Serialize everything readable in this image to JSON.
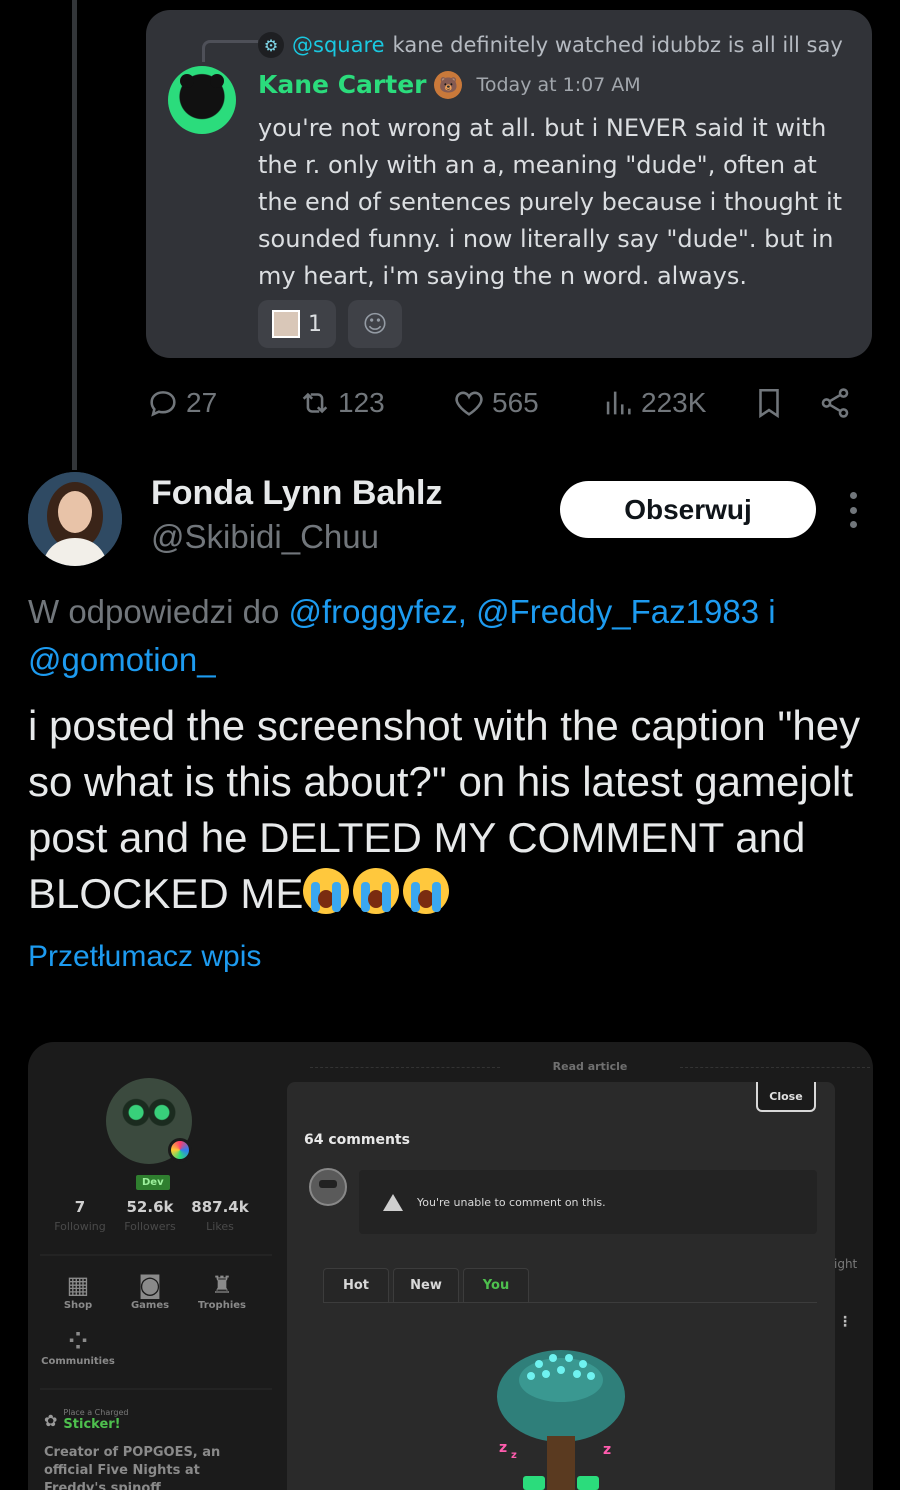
{
  "discord": {
    "reply_name": "@square",
    "reply_text": "kane definitely watched idubbz is all ill say",
    "author": "Kane Carter",
    "timestamp": "Today at 1:07 AM",
    "message": "you're not wrong at all. but i NEVER said it with the r. only with an a, meaning \"dude\", often at the end of sentences purely because i thought it sounded funny. i now literally say \"dude\". but in my heart, i'm saying the n word. always.",
    "reaction_count": "1",
    "icons": {
      "reply_avatar": "robot-avatar-icon",
      "author_badge": "bear-badge-icon",
      "add_reaction": "add-reaction-icon"
    }
  },
  "actions": {
    "replies": "27",
    "reposts": "123",
    "likes": "565",
    "views": "223K",
    "icons": [
      "reply-icon",
      "repost-icon",
      "like-icon",
      "views-icon",
      "bookmark-icon",
      "share-icon"
    ]
  },
  "tweet": {
    "author_name": "Fonda Lynn Bahlz",
    "handle": "@Skibidi_Chuu",
    "follow_label": "Obserwuj",
    "reply_prefix": "W odpowiedzi do",
    "mention_1": "@froggyfez,",
    "mention_2": "@Freddy_Faz1983",
    "reply_and": "i",
    "mention_3": "@gomotion_",
    "text": "i posted the screenshot with the caption \"hey so what is this about?\" on his latest gamejolt post and he DELTED MY COMMENT and BLOCKED ME",
    "emoji": "loudly-crying-face x3",
    "translate_label": "Przetłumacz wpis",
    "colors": {
      "link": "#1d9bf0",
      "muted": "#71767b",
      "text": "#e7e9ea"
    }
  },
  "gamejolt": {
    "dev_tag": "Dev",
    "stats": [
      {
        "num": "7",
        "label": "Following"
      },
      {
        "num": "52.6k",
        "label": "Followers"
      },
      {
        "num": "887.4k",
        "label": "Likes"
      }
    ],
    "nav": [
      {
        "label": "Shop",
        "icon": "shop-icon"
      },
      {
        "label": "Games",
        "icon": "gamepad-icon"
      },
      {
        "label": "Trophies",
        "icon": "trophy-icon"
      },
      {
        "label": "Communities",
        "icon": "communities-icon"
      }
    ],
    "sticker_small": "Place a Charged",
    "sticker_big": "Sticker!",
    "creator_text": "Creator of POPGOES, an official Five Nights at Freddy's spinoff",
    "read_article": "Read article",
    "close_label": "Close",
    "comments_title": "64 comments",
    "unable_text": "You're unable to comment on this.",
    "tabs": [
      "Hot",
      "New",
      "You"
    ],
    "active_tab": "You",
    "side_text": "ight"
  }
}
